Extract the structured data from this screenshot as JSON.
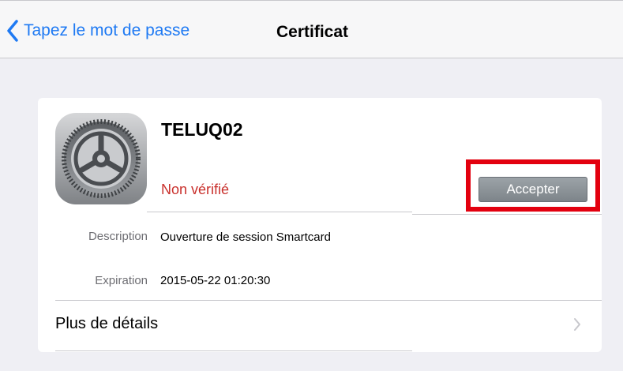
{
  "navbar": {
    "back_label": "Tapez le mot de passe",
    "title": "Certificat",
    "accent_color": "#1f7af3"
  },
  "certificate": {
    "icon": "settings-gear-icon",
    "name": "TELUQ02",
    "status": "Non vérifié",
    "status_color": "#c9302c",
    "accept_label": "Accepter",
    "highlight_color": "#e3000f"
  },
  "details": {
    "description_label": "Description",
    "description_value": "Ouverture de session Smartcard",
    "expiration_label": "Expiration",
    "expiration_value": "2015-05-22 01:20:30"
  },
  "more": {
    "label": "Plus de détails",
    "icon": "chevron-right-icon"
  }
}
